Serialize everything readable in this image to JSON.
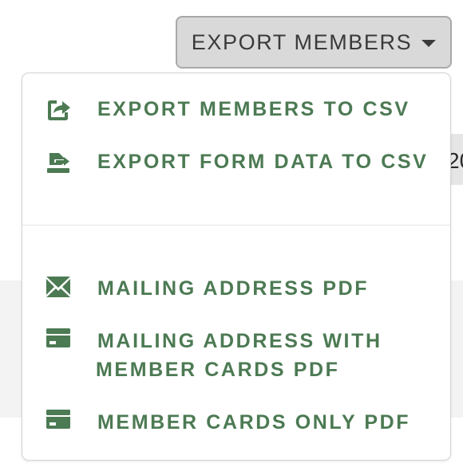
{
  "background": {
    "partial_text": "20"
  },
  "export_button": {
    "label": "EXPORT MEMBERS"
  },
  "menu": {
    "items": [
      {
        "label": "EXPORT MEMBERS TO CSV",
        "icon": "share-export-icon"
      },
      {
        "label": "EXPORT FORM DATA TO CSV",
        "icon": "file-export-icon"
      },
      {
        "label": "MAILING ADDRESS PDF",
        "icon": "envelope-icon"
      },
      {
        "label_line1": "MAILING ADDRESS WITH",
        "label_line2": "MEMBER CARDS PDF",
        "icon": "credit-card-icon"
      },
      {
        "label": "MEMBER CARDS ONLY PDF",
        "icon": "credit-card-icon"
      }
    ]
  },
  "colors": {
    "menu_text": "#4c7a53",
    "icon": "#4c7a53",
    "button_bg": "#d9d9d9",
    "button_text": "#3a3a3a"
  }
}
